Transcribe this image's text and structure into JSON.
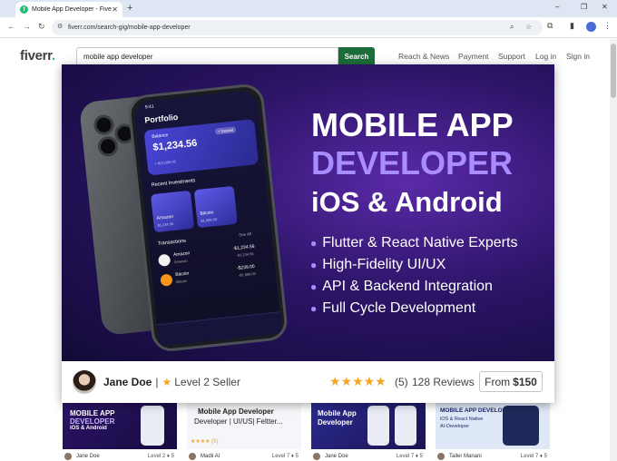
{
  "browser": {
    "tab_title": "Mobile App Developer - Fiverr",
    "url": "fiverr.com/search-gig/mobile-app-developer",
    "new_tab": "+",
    "tab_close": "✕",
    "win_min": "–",
    "win_max": "❐",
    "win_close": "✕"
  },
  "header": {
    "logo": "fiverr",
    "logo_dot": ".",
    "search_value": "mobile app developer",
    "search_button": "Search",
    "nav": [
      "Reach & News",
      "Payment",
      "Support",
      "Log in",
      "Sign in"
    ]
  },
  "banner": {
    "line1": "MOBILE APP",
    "line2": "DEVELOPER",
    "line3": "iOS & Android",
    "bullets": [
      "Flutter & React Native Experts",
      "High-Fidelity UI/UX",
      "API & Backend Integration",
      "Full Cycle Development"
    ],
    "phone": {
      "time": "9:41",
      "title": "Portfolio",
      "balance_label": "Balance",
      "balance": "$1,234.56",
      "deposit": "+ Deposit",
      "balance_sub": "+ $24,000.00",
      "recent": "Recent Investments",
      "inv": [
        {
          "name": "Amazon",
          "value": "$1,234.56"
        },
        {
          "name": "Bitcoin",
          "value": "$1,999.00"
        }
      ],
      "transactions": "Transactions",
      "see_all": "See All",
      "tx": [
        {
          "name": "Amazon",
          "sub": "Amazon",
          "amount": "-$1,234.56",
          "amount_sub": "-$1,234.56"
        },
        {
          "name": "Bitcoin",
          "sub": "Bitcoin",
          "amount": "-$239.00",
          "amount_sub": "-$1,999.00"
        }
      ]
    }
  },
  "seller": {
    "name": "Jane Doe",
    "separator": "|",
    "level": "Level 2 Seller",
    "stars": "★★★★★",
    "rating_count": "(5)",
    "reviews": "128 Reviews",
    "price_prefix": "From",
    "price": "$150"
  },
  "cards": [
    {
      "title1": "MOBILE APP",
      "title2": "DEVELOPER",
      "title3": "iOS & Android",
      "seller": "Jane Doe",
      "level": "Level 2 ♦ 5"
    },
    {
      "title1": "Mobile App Developer",
      "title2": "Developer | UI/US| Feltter...",
      "rating": "★★★★ (5)",
      "seller": "Madii Al",
      "level": "Level 7 ♦ 5"
    },
    {
      "title1": "Mobile App",
      "title2": "Developer",
      "seller": "Jane Doe",
      "level": "Level 7 ♦ 5"
    },
    {
      "title1": "MOBILE APP DEVELOPER",
      "title2": "iOS & React Native",
      "title3": "AI-Developer",
      "seller": "Taller Manani",
      "level": "Level 7 ♦ 5"
    }
  ],
  "colors": {
    "brand_green": "#1dbf73",
    "search_btn": "#1c6e38",
    "banner_purple": "#2b1466",
    "accent_purple": "#a98cff",
    "star": "#f5a623"
  }
}
